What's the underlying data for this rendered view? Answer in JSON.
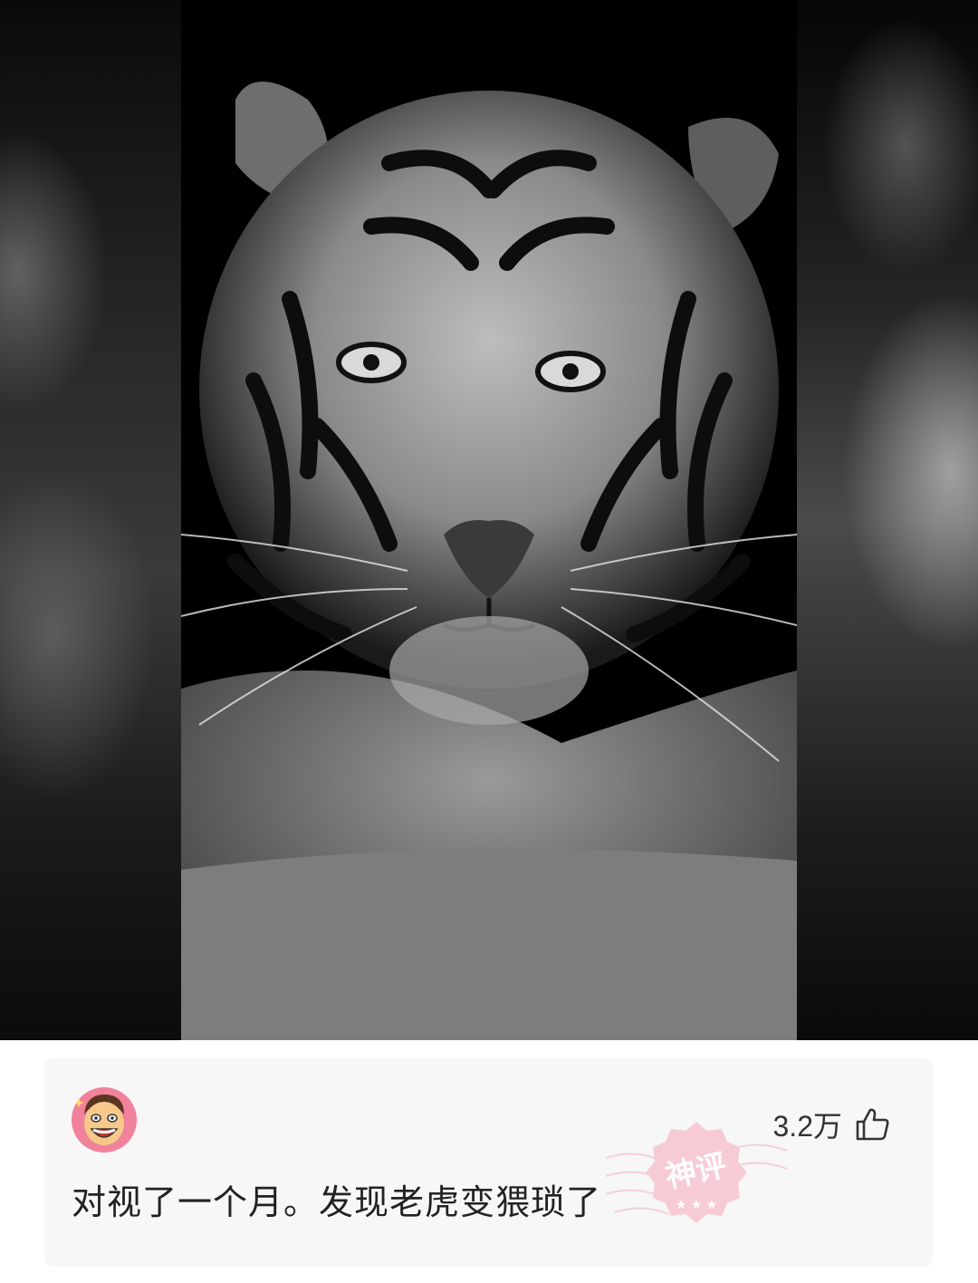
{
  "post": {
    "image_alt_icon": "tiger-photo"
  },
  "comment": {
    "avatar_icon": "cartoon-face-avatar",
    "like_count": "3.2万",
    "like_icon": "thumbs-up-icon",
    "text": "对视了一个月。发现老虎变猥琐了",
    "badge_text": "神评",
    "badge_color": "#f5b6c6"
  }
}
